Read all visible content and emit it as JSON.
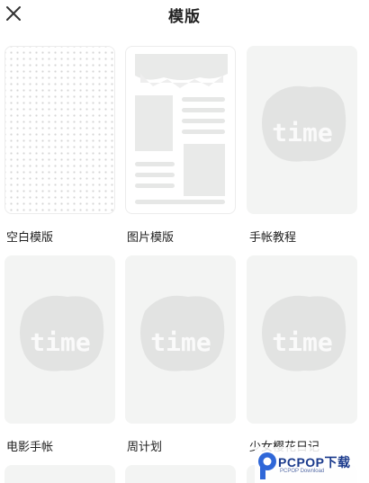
{
  "header": {
    "title": "模版",
    "close_icon": "close-icon"
  },
  "templates": [
    {
      "label": "空白模版",
      "style": "dot-grid"
    },
    {
      "label": "图片模版",
      "style": "picture-layout"
    },
    {
      "label": "手帐教程",
      "style": "time-placeholder",
      "art_text": "time"
    },
    {
      "label": "电影手帐",
      "style": "time-placeholder",
      "art_text": "time"
    },
    {
      "label": "周计划",
      "style": "time-placeholder",
      "art_text": "time"
    },
    {
      "label": "少女樱花日记",
      "style": "time-placeholder",
      "art_text": "time"
    }
  ],
  "watermark": {
    "brand": "PCPOP下载",
    "sub": "PCPOP Download"
  },
  "colors": {
    "card_bg": "#f3f4f3",
    "placeholder_blob": "#e3e4e3",
    "text": "#222222"
  }
}
